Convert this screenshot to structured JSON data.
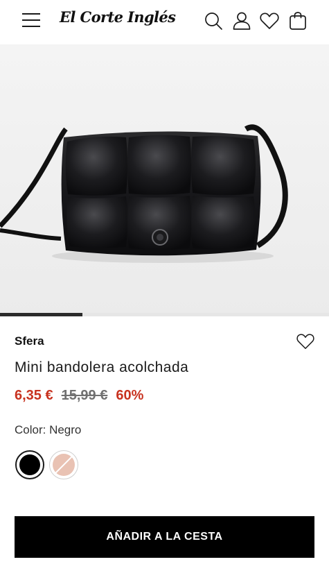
{
  "header": {
    "logo_text": "El Corte Inglés",
    "icons": [
      "menu-icon",
      "search-icon",
      "user-icon",
      "heart-icon",
      "shopping-bag-icon"
    ]
  },
  "gallery": {
    "image_description_icon": "quilted-black-crossbody-bag",
    "progress": 0.25
  },
  "product": {
    "brand": "Sfera",
    "title": "Mini bandolera acolchada",
    "price_current": "6,35 €",
    "price_original": "15,99 €",
    "discount": "60%",
    "color_label": "Color: Negro",
    "swatches": [
      {
        "name": "Negro",
        "color": "#000000",
        "selected": true
      },
      {
        "name": "Rosa",
        "color": "#e9c2b3",
        "selected": false,
        "unavailable": true
      }
    ]
  },
  "actions": {
    "add_to_cart": "AÑADIR A LA CESTA"
  },
  "colors": {
    "accent_price": "#c8321f",
    "button_bg": "#000000"
  }
}
